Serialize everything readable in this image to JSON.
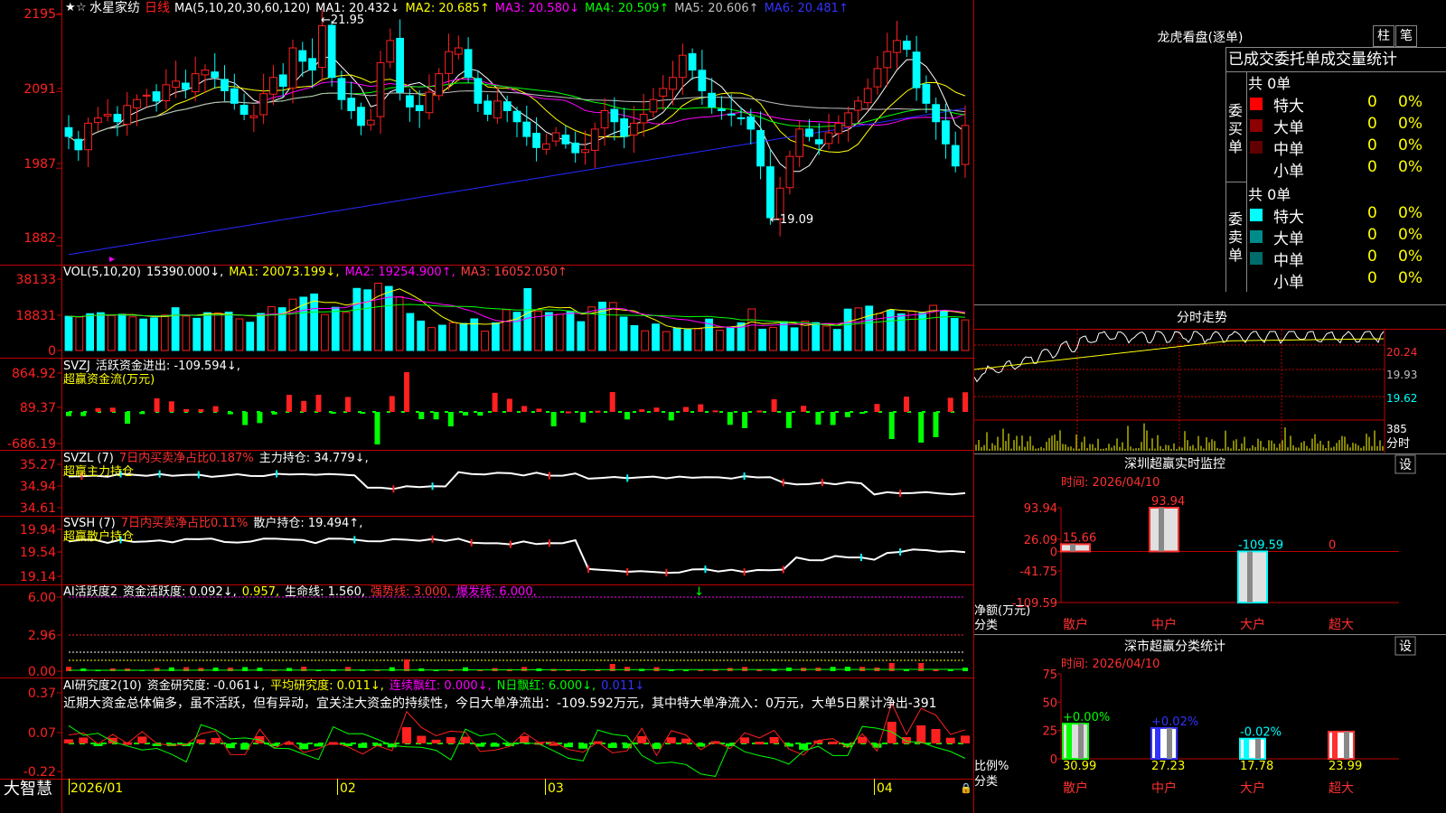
{
  "app": {
    "name": "大智慧"
  },
  "stock": {
    "name": "水星家纺",
    "period": "日线"
  },
  "legends": {
    "ma": {
      "label": "MA(5,10,20,30,60,120)",
      "items": [
        {
          "t": "MA1: 20.432↓",
          "c": "#ffffff"
        },
        {
          "t": "MA2: 20.685↑",
          "c": "#ffff00"
        },
        {
          "t": "MA3: 20.580↓",
          "c": "#ff00ff"
        },
        {
          "t": "MA4: 20.509↑",
          "c": "#00ff00"
        },
        {
          "t": "MA5: 20.606↑",
          "c": "#c0c0c0"
        },
        {
          "t": "MA6: 20.481↑",
          "c": "#3333ff"
        }
      ]
    },
    "vol": {
      "label": "VOL(5,10,20)",
      "items": [
        {
          "t": "15390.000↓,",
          "c": "#ffffff"
        },
        {
          "t": "MA1: 20073.199↓,",
          "c": "#ffff00"
        },
        {
          "t": "MA2: 19254.900↑,",
          "c": "#ff00ff"
        },
        {
          "t": "MA3: 16052.050↑",
          "c": "#ff4040"
        }
      ]
    },
    "svzj": {
      "label": "SVZJ",
      "items": [
        {
          "t": "活跃资金进出: -109.594↓,",
          "c": "#ffffff"
        }
      ],
      "sub": "超赢资金流(万元)"
    },
    "svzl": {
      "label": "SVZL (7)",
      "items": [
        {
          "t": "7日内买卖净占比0.187%",
          "c": "#ff3030"
        },
        {
          "t": "主力持仓: 34.779↓,",
          "c": "#ffffff"
        }
      ],
      "sub": "超赢主力持仓"
    },
    "svsh": {
      "label": "SVSH (7)",
      "items": [
        {
          "t": "7日内买卖净占比0.11%",
          "c": "#ff3030"
        },
        {
          "t": "散户持仓: 19.494↑,",
          "c": "#ffffff"
        }
      ],
      "sub": "超赢散户持仓"
    },
    "ai1": {
      "label": "AI活跃度2",
      "items": [
        {
          "t": "资金活跃度: 0.092↓,",
          "c": "#ffffff"
        },
        {
          "t": "0.957,",
          "c": "#ffff00"
        },
        {
          "t": "生命线: 1.560,",
          "c": "#ffffff"
        },
        {
          "t": "强势线: 3.000,",
          "c": "#ff3030"
        },
        {
          "t": "爆发线: 6.000,",
          "c": "#ff00ff"
        }
      ]
    },
    "ai2": {
      "label": "AI研究度2(10)",
      "items": [
        {
          "t": "资金研究度: -0.061↓,",
          "c": "#ffffff"
        },
        {
          "t": "平均研究度: 0.011↓,",
          "c": "#ffff00"
        },
        {
          "t": "连续飘红: 0.000↓,",
          "c": "#ff00ff"
        },
        {
          "t": "N日飘红: 6.000↓,",
          "c": "#00ff00"
        },
        {
          "t": "0.011↓",
          "c": "#3333ff"
        }
      ],
      "comment": "近期大资金总体偏多，虽不活跃，但有异动，宜关注大资金的持续性，今日大单净流出：-109.592万元，其中特大单净流入：0万元，大单5日累计净出-391"
    }
  },
  "axes": {
    "price": [
      "2195",
      "2091",
      "1987",
      "1882"
    ],
    "vol": [
      "38133",
      "18831",
      "0"
    ],
    "svzj": [
      "864.92",
      "89.37",
      "-686.19"
    ],
    "svzl": [
      "35.27",
      "34.94",
      "34.61"
    ],
    "svsh": [
      "19.94",
      "19.54",
      "19.14"
    ],
    "ai1": [
      "6.00",
      "2.96",
      "0.00"
    ],
    "ai2": [
      "0.37",
      "0.07",
      "-0.22"
    ],
    "dates": [
      "2026/01",
      "02",
      "03",
      "04"
    ]
  },
  "annotations": {
    "high": "21.95",
    "low": "19.09"
  },
  "right": {
    "lhb": {
      "title": "龙虎看盘(逐单)",
      "btn1": "柱",
      "btn2": "笔",
      "header": "已成交委托单成交量统计",
      "buy_label": "委买单",
      "sell_label": "委卖单",
      "buy_total": "共 0单",
      "sell_total": "共 0单",
      "buy_rows": [
        {
          "name": "特大",
          "v": "0",
          "p": "0%",
          "c": "#ff0000"
        },
        {
          "name": "大单",
          "v": "0",
          "p": "0%",
          "c": "#8b0000"
        },
        {
          "name": "中单",
          "v": "0",
          "p": "0%",
          "c": "#600000"
        },
        {
          "name": "小单",
          "v": "0",
          "p": "0%",
          "c": ""
        }
      ],
      "sell_rows": [
        {
          "name": "特大",
          "v": "0",
          "p": "0%",
          "c": "#00ffff"
        },
        {
          "name": "大单",
          "v": "0",
          "p": "0%",
          "c": "#008b8b"
        },
        {
          "name": "中单",
          "v": "0",
          "p": "0%",
          "c": "#006b6b"
        },
        {
          "name": "小单",
          "v": "0",
          "p": "0%",
          "c": ""
        }
      ]
    },
    "fs": {
      "title": "分时走势",
      "ticks": [
        "20.24",
        "19.93",
        "19.62",
        "385"
      ],
      "vol_label": "分时"
    },
    "sz": {
      "title": "深圳超赢实时监控",
      "btn": "设",
      "time": "时间: 2026/04/10",
      "ticks": [
        "93.94",
        "26.09",
        "0",
        "-41.75",
        "-109.59"
      ],
      "ylabel": "净额(万元)",
      "xlabel": "分类",
      "cats": [
        "散户",
        "中户",
        "大户",
        "超大"
      ],
      "vals": [
        15.66,
        93.94,
        -109.59,
        0
      ],
      "labels": [
        "15.66",
        "93.94",
        "-109.59",
        "0"
      ]
    },
    "sh": {
      "title": "深市超赢分类统计",
      "btn": "设",
      "time": "时间: 2026/04/10",
      "ticks": [
        "75",
        "50",
        "25",
        "0"
      ],
      "ylabel": "比例%",
      "xlabel": "分类",
      "cats": [
        "散户",
        "中户",
        "大户",
        "超大"
      ],
      "vals": [
        30.99,
        27.23,
        17.78,
        23.99
      ],
      "labels": [
        "30.99",
        "27.23",
        "17.78",
        "23.99"
      ],
      "changes": [
        "+0.00%",
        "+0.02%",
        "-0.02%",
        ""
      ],
      "colors": [
        "#00ff00",
        "#3333ff",
        "#00ffff",
        "#ff3030"
      ]
    }
  },
  "chart_data": [
    {
      "type": "candlestick",
      "title": "水星家纺 日线",
      "ylim": [
        1860,
        2210
      ],
      "x": [
        "2026/01",
        "02",
        "03",
        "04"
      ],
      "ma_current": {
        "MA1": 20.432,
        "MA2": 20.685,
        "MA3": 20.58,
        "MA4": 20.509,
        "MA5": 20.606,
        "MA6": 20.481
      },
      "annotations": [
        {
          "text": "21.95",
          "kind": "high"
        },
        {
          "text": "19.09",
          "kind": "low"
        }
      ],
      "closes": [
        2030,
        2012,
        2048,
        2055,
        2060,
        2050,
        2072,
        2080,
        2086,
        2078,
        2100,
        2105,
        2094,
        2115,
        2120,
        2110,
        2092,
        2075,
        2060,
        2058,
        2088,
        2110,
        2098,
        2150,
        2132,
        2120,
        2180,
        2110,
        2080,
        2065,
        2045,
        2052,
        2130,
        2160,
        2090,
        2070,
        2065,
        2090,
        2115,
        2145,
        2150,
        2110,
        2075,
        2060,
        2078,
        2065,
        2050,
        2030,
        2015,
        2020,
        2035,
        2020,
        2008,
        2012,
        2040,
        2065,
        2050,
        2030,
        2048,
        2060,
        2080,
        2095,
        2110,
        2140,
        2120,
        2092,
        2070,
        2065,
        2060,
        2055,
        2040,
        1990,
        1920,
        1960,
        2003,
        2040,
        2030,
        2020,
        2035,
        2048,
        2062,
        2078,
        2095,
        2122,
        2145,
        2160,
        2148,
        2096,
        2075,
        2050,
        2020,
        1990,
        2045
      ]
    },
    {
      "type": "bar",
      "title": "VOL(5,10,20)",
      "ylim": [
        0,
        38133
      ],
      "values": [
        17200,
        16800,
        18500,
        19000,
        17600,
        18200,
        16900,
        15800,
        16400,
        17800,
        21500,
        17300,
        16200,
        19000,
        18800,
        19300,
        15900,
        14200,
        18600,
        22000,
        21500,
        25800,
        26800,
        28400,
        18100,
        21700,
        19200,
        31200,
        30500,
        33800,
        32200,
        27000,
        18600,
        14800,
        11500,
        12700,
        14000,
        13600,
        15900,
        9700,
        13900,
        20500,
        19200,
        31100,
        19800,
        19100,
        18200,
        19800,
        14500,
        21900,
        24300,
        24100,
        16800,
        12500,
        9900,
        13300,
        9500,
        11300,
        10500,
        10900,
        15800,
        10200,
        11700,
        13900,
        20900,
        10700,
        11600,
        14500,
        11400,
        14700,
        14000,
        12300,
        10600,
        20800,
        21400,
        22300,
        18600,
        20300,
        18400,
        19800,
        18800,
        22700,
        20100,
        16100,
        15390
      ]
    }
  ]
}
